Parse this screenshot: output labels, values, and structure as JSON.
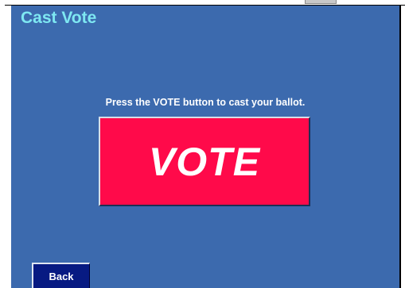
{
  "screen": {
    "title": "Cast Vote",
    "instruction": "Press the VOTE button to cast your ballot.",
    "vote_label": "VOTE",
    "back_label": "Back"
  },
  "colors": {
    "panel_background": "#3c6aae",
    "title_text": "#7ee8f2",
    "vote_button": "#ff0a4a",
    "back_button": "#071a82"
  }
}
